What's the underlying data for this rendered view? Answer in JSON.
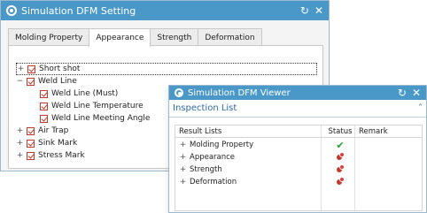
{
  "setting": {
    "title": "Simulation DFM Setting",
    "refresh_label": "↻",
    "close_label": "✕",
    "tabs": [
      "Molding Property",
      "Appearance",
      "Strength",
      "Deformation"
    ],
    "tree": [
      {
        "label": "Short shot",
        "expander": "+",
        "checked": true
      },
      {
        "label": "Weld Line",
        "expander": "−",
        "checked": true
      },
      {
        "label": "Weld Line (Must)",
        "checked": true
      },
      {
        "label": "Weld Line Temperature",
        "checked": true
      },
      {
        "label": "Weld Line Meeting Angle",
        "checked": true
      },
      {
        "label": "Air Trap",
        "expander": "+",
        "checked": true
      },
      {
        "label": "Sink Mark",
        "expander": "+",
        "checked": true
      },
      {
        "label": "Stress Mark",
        "expander": "+",
        "checked": true
      }
    ]
  },
  "viewer": {
    "title": "Simulation DFM Viewer",
    "refresh_label": "↻",
    "close_label": "✕",
    "section_title": "Inspection List",
    "collapse_label": "˄",
    "columns": [
      "Result Lists",
      "Status",
      "Remark"
    ],
    "rows": [
      {
        "label": "Molding Property",
        "expander": "+",
        "status": "pass"
      },
      {
        "label": "Appearance",
        "expander": "+",
        "status": "warning"
      },
      {
        "label": "Strength",
        "expander": "+",
        "status": "warning"
      },
      {
        "label": "Deformation",
        "expander": "+",
        "status": "warning"
      }
    ],
    "check_glyph": "✔"
  }
}
